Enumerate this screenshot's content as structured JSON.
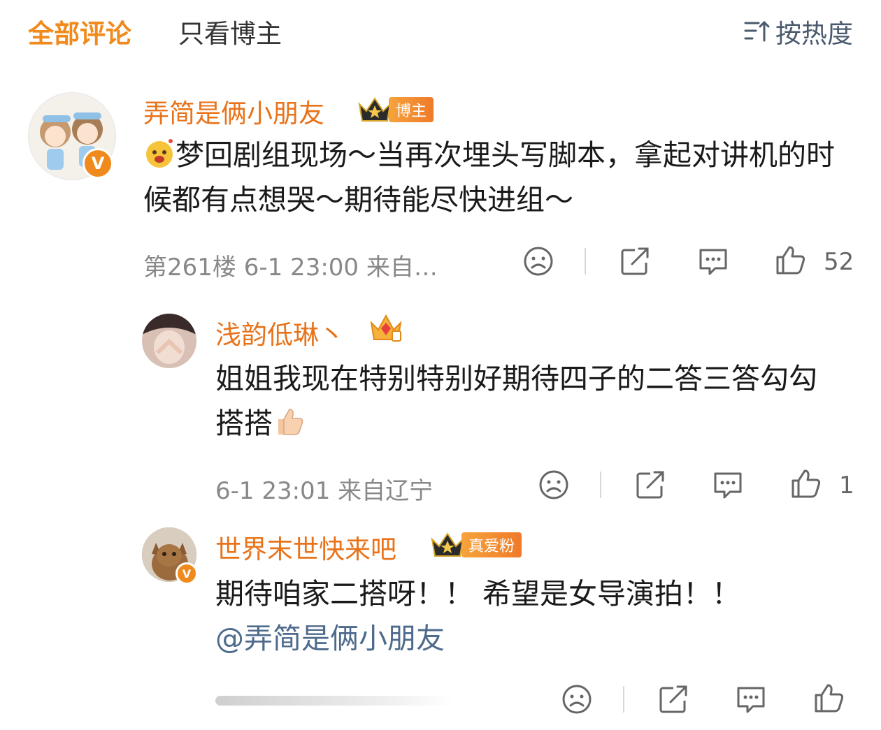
{
  "tabs": {
    "all_label": "全部评论",
    "blogger_only_label": "只看博主",
    "sort_label": "按热度",
    "sort_icon": "sort-icon"
  },
  "colors": {
    "accent": "#f08a1c",
    "username": "#e8731a",
    "mention": "#4e6a8c",
    "meta": "#888888"
  },
  "comments": [
    {
      "username": "弄简是俩小朋友",
      "badge": "博主",
      "content_pre_emoji": "face-with-hearts-emoji",
      "content": "梦回剧组现场～当再次埋头写脚本，拿起对讲机的时候都有点想哭～期待能尽快进组～",
      "floor": "第261楼",
      "time": "6-1 23:00",
      "source": "来自…",
      "like_count": "52"
    },
    {
      "username": "浅韵低琳丶",
      "content": "姐姐我现在特别特别好期待四子的二答三答勾勾搭搭",
      "content_post_emoji": "thumbs-up-emoji",
      "time": "6-1 23:01",
      "source": "来自辽宁",
      "like_count": "1"
    },
    {
      "username": "世界末世快来吧",
      "badge": "真爱粉",
      "content": "期待咱家二搭呀！！ 希望是女导演拍！！",
      "mention": "@弄简是俩小朋友"
    }
  ]
}
